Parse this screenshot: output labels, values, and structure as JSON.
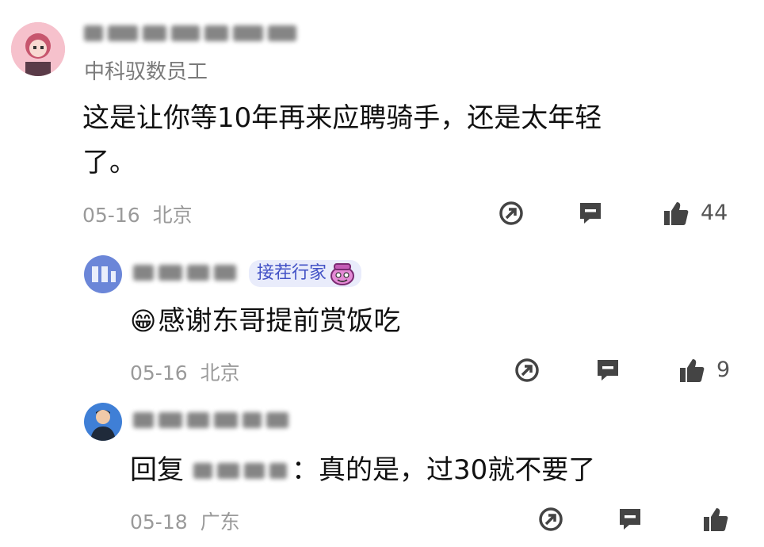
{
  "comments": [
    {
      "user_tag": "中科驭数员工",
      "text": "这是让你等10年再来应聘骑手，还是太年轻了。",
      "text_line1": "这是让你等10年再来应聘骑手，还是太年轻",
      "text_line2": "了。",
      "date": "05-16",
      "location": "北京",
      "likes": "44"
    },
    {
      "badge": "接茬行家",
      "emoji": "😁",
      "text": "感谢东哥提前赏饭吃",
      "date": "05-16",
      "location": "北京",
      "likes": "9"
    },
    {
      "reply_prefix": "回复",
      "text": "：真的是，过30就不要了",
      "date": "05-18",
      "location": "广东",
      "likes": ""
    }
  ],
  "icons": {
    "share": "share-icon",
    "reply": "comment-icon",
    "like": "thumbs-up-icon"
  },
  "colors": {
    "badge_bg": "#e9ecfb",
    "badge_text": "#4352c6",
    "meta": "#9a9a9a"
  }
}
